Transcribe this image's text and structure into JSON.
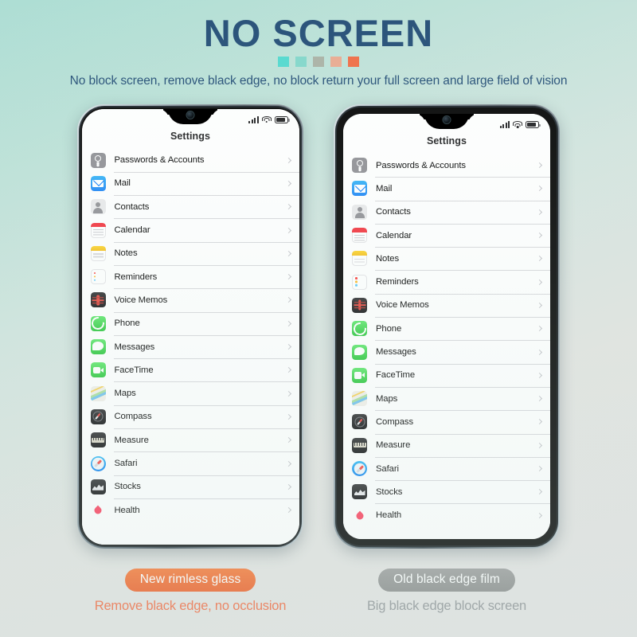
{
  "header": {
    "title": "NO SCREEN",
    "subtitle": "No block screen, remove black edge, no block return your full screen and large field of vision",
    "title_color": "#1f4a73",
    "dots": [
      "#4fd8cd",
      "#7fd6c9",
      "#a8b0a3",
      "#e9a98e",
      "#ef6a42"
    ]
  },
  "background": {
    "from": "#a9dcd2",
    "to": "#e5e3e3"
  },
  "phone_ui": {
    "nav_title": "Settings",
    "status": {
      "signal_icon": "signal-bars-icon",
      "wifi_icon": "wifi-icon",
      "battery_icon": "battery-icon"
    },
    "rows": [
      {
        "label": "Passwords & Accounts",
        "icon": "passwords-icon"
      },
      {
        "label": "Mail",
        "icon": "mail-icon"
      },
      {
        "label": "Contacts",
        "icon": "contacts-icon"
      },
      {
        "label": "Calendar",
        "icon": "calendar-icon"
      },
      {
        "label": "Notes",
        "icon": "notes-icon"
      },
      {
        "label": "Reminders",
        "icon": "reminders-icon"
      },
      {
        "label": "Voice Memos",
        "icon": "voice-memos-icon"
      },
      {
        "label": "Phone",
        "icon": "phone-icon"
      },
      {
        "label": "Messages",
        "icon": "messages-icon"
      },
      {
        "label": "FaceTime",
        "icon": "facetime-icon"
      },
      {
        "label": "Maps",
        "icon": "maps-icon"
      },
      {
        "label": "Compass",
        "icon": "compass-icon"
      },
      {
        "label": "Measure",
        "icon": "measure-icon"
      },
      {
        "label": "Safari",
        "icon": "safari-icon"
      },
      {
        "label": "Stocks",
        "icon": "stocks-icon"
      },
      {
        "label": "Health",
        "icon": "health-icon"
      }
    ]
  },
  "left_phone": {
    "badge": "New rimless glass",
    "caption": "Remove black edge, no occlusion",
    "badge_color": "#f05a20",
    "caption_color": "#f4663c"
  },
  "right_phone": {
    "badge": "Old black edge film",
    "caption": "Big black edge block screen",
    "badge_color": "#898989",
    "caption_color": "#8f9296"
  }
}
